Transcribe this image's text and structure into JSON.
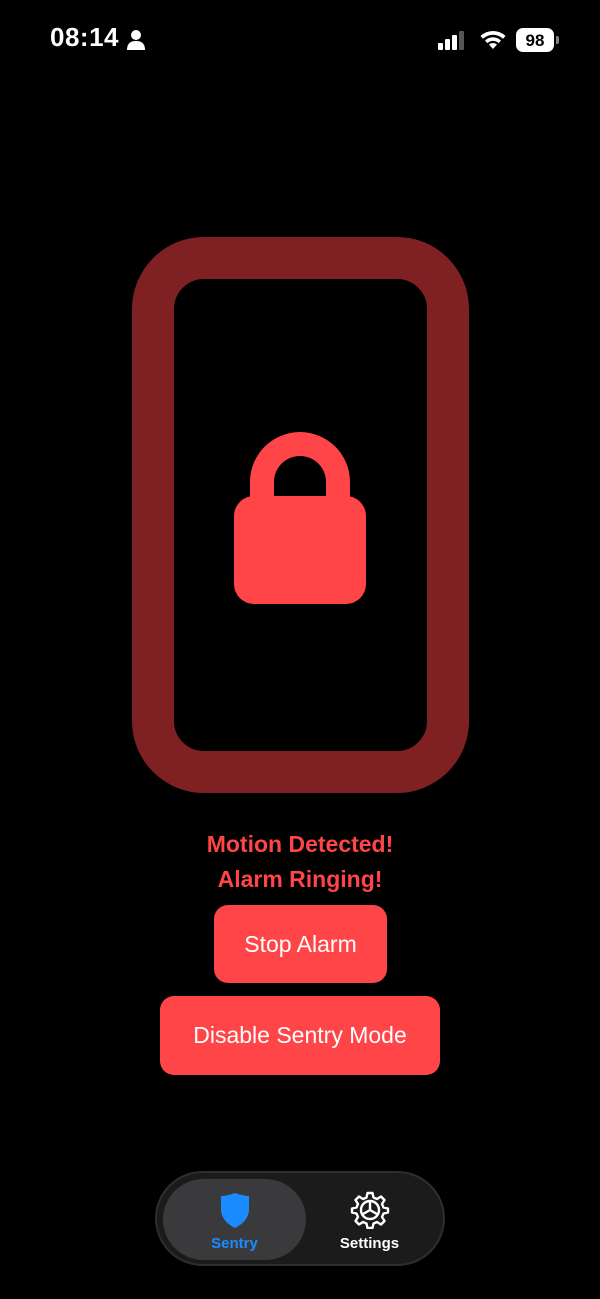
{
  "status_bar": {
    "time": "08:14",
    "battery": "98"
  },
  "main": {
    "alert_line_1": "Motion Detected!",
    "alert_line_2": "Alarm Ringing!",
    "stop_alarm_label": "Stop Alarm",
    "disable_sentry_label": "Disable Sentry Mode"
  },
  "tab_bar": {
    "tabs": [
      {
        "label": "Sentry",
        "icon": "shield-icon",
        "selected": true
      },
      {
        "label": "Settings",
        "icon": "gear-icon",
        "selected": false
      }
    ]
  },
  "colors": {
    "accent_red": "#ff4547",
    "frame_red": "#7f2123",
    "tab_selected_blue": "#1a8cff",
    "background": "#000000"
  }
}
